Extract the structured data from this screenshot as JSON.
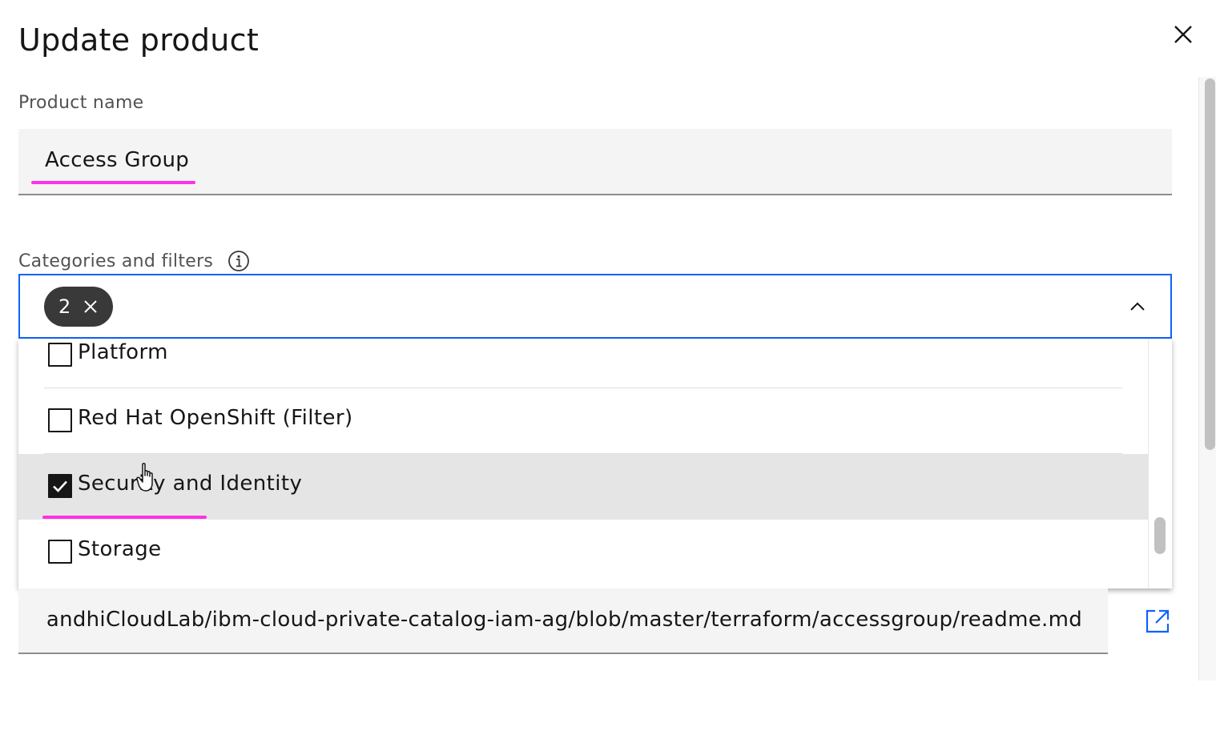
{
  "modal": {
    "title": "Update product",
    "close_icon": "close-icon"
  },
  "product_name": {
    "label": "Product name",
    "value": "Access Group"
  },
  "categories": {
    "label": "Categories and filters",
    "info_icon": "info-icon",
    "selected_count": "2",
    "tag_remove_icon": "close-icon",
    "toggle_icon": "chevron-up-icon",
    "items": [
      {
        "label": "Platform",
        "checked": false
      },
      {
        "label": "Red Hat OpenShift (Filter)",
        "checked": false
      },
      {
        "label": "Security and Identity",
        "checked": true
      },
      {
        "label": "Storage",
        "checked": false
      }
    ]
  },
  "readme_url": {
    "value": "andhiCloudLab/ibm-cloud-private-catalog-iam-ag/blob/master/terraform/accessgroup/readme.md",
    "external_link_icon": "launch-icon"
  },
  "colors": {
    "accent": "#0f62fe",
    "highlight": "#ff30e6",
    "tag_bg": "#393939",
    "field_bg": "#f4f4f4",
    "selected_row_bg": "#e5e5e5"
  }
}
